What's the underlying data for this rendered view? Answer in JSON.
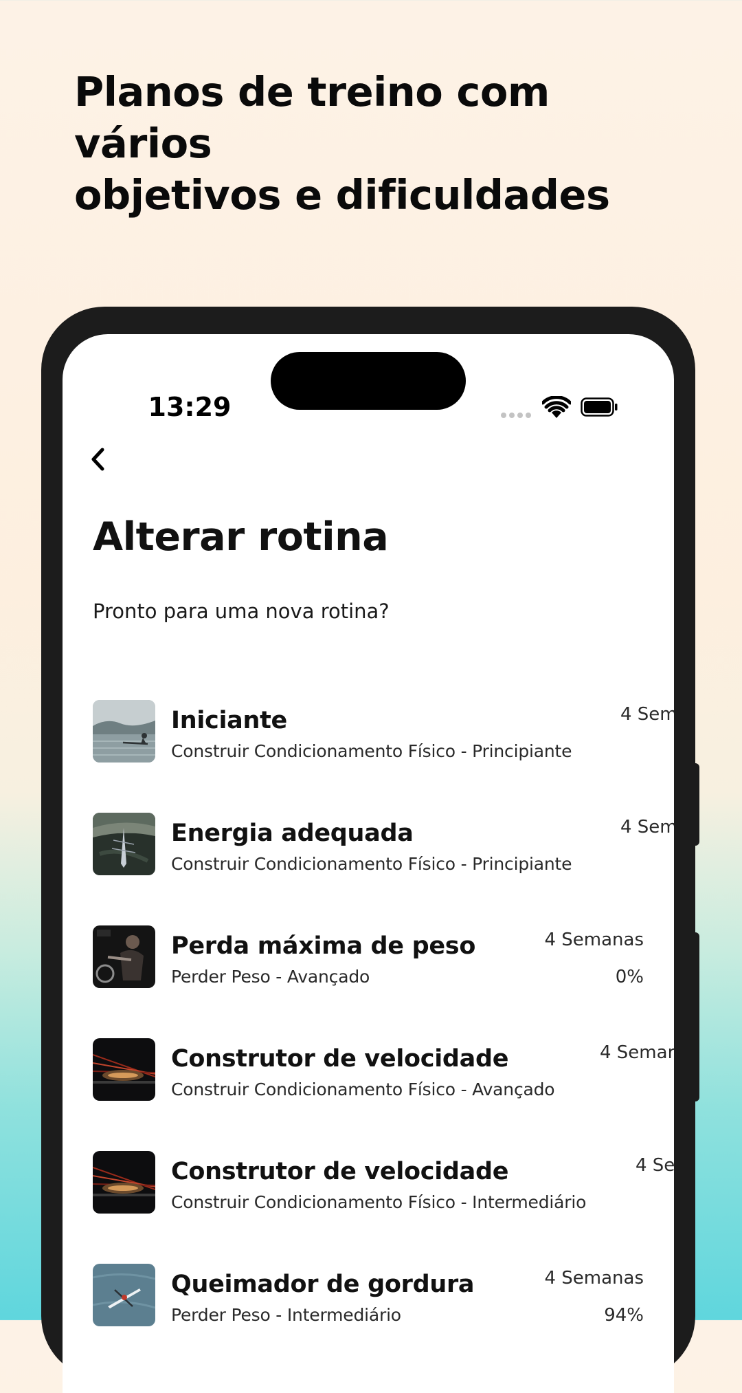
{
  "promo": {
    "headline_line1": "Planos de treino com vários",
    "headline_line2": "objetivos e dificuldades"
  },
  "status_bar": {
    "time": "13:29",
    "icons": [
      "signal-dots-icon",
      "wifi-icon",
      "battery-icon"
    ]
  },
  "header": {
    "back_icon": "chevron-left-icon",
    "title": "Alterar rotina",
    "subtitle": "Pronto para uma nova rotina?"
  },
  "routines": [
    {
      "title": "Iniciante",
      "description": "Construir Condicionamento Físico - Principiante",
      "duration": "4 Sem",
      "progress": "",
      "thumbnail": "rowing-on-lake-image"
    },
    {
      "title": "Energia adequada",
      "description": "Construir Condicionamento Físico - Principiante",
      "duration": "4 Sem",
      "progress": "",
      "thumbnail": "rowing-boat-aerial-image"
    },
    {
      "title": "Perda máxima de peso",
      "description": "Perder Peso - Avançado",
      "duration": "4 Semanas",
      "progress": "0%",
      "thumbnail": "indoor-rowing-athlete-image"
    },
    {
      "title": "Construtor de velocidade",
      "description": "Construir Condicionamento Físico - Avançado",
      "duration": "4 Semar",
      "progress": "",
      "thumbnail": "speed-lights-image"
    },
    {
      "title": "Construtor de velocidade",
      "description": "Construir Condicionamento Físico - Intermediário",
      "duration": "4 Se",
      "progress": "",
      "thumbnail": "speed-lights-image"
    },
    {
      "title": "Queimador de gordura",
      "description": "Perder Peso - Intermediário",
      "duration": "4 Semanas",
      "progress": "94%",
      "thumbnail": "kayak-on-water-image"
    }
  ],
  "colors": {
    "background_top": "#fdf2e6",
    "background_bottom": "#5fd6dd",
    "phone_frame": "#1c1c1c",
    "text_primary": "#111111"
  }
}
